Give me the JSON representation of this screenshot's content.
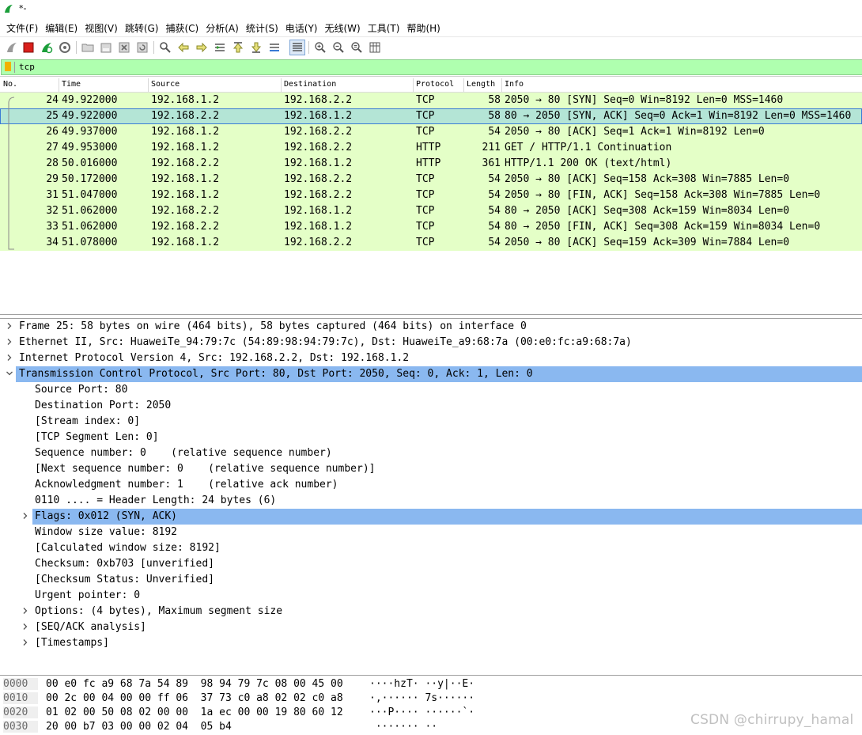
{
  "window": {
    "title": "*-"
  },
  "menu": [
    "文件(F)",
    "编辑(E)",
    "视图(V)",
    "跳转(G)",
    "捕获(C)",
    "分析(A)",
    "统计(S)",
    "电话(Y)",
    "无线(W)",
    "工具(T)",
    "帮助(H)"
  ],
  "toolbar": {
    "icons": [
      "shark-fin-icon",
      "stop-capture-icon",
      "restart-capture-icon",
      "capture-options-icon",
      "open-file-icon",
      "save-file-icon",
      "close-file-icon",
      "reload-file-icon",
      "find-packet-icon",
      "go-back-icon",
      "go-forward-icon",
      "go-to-packet-icon",
      "go-first-icon",
      "go-last-icon",
      "auto-scroll-icon",
      "colorize-icon",
      "zoom-in-icon",
      "zoom-out-icon",
      "zoom-normal-icon",
      "resize-columns-icon"
    ]
  },
  "filter": {
    "value": "tcp"
  },
  "packet_list": {
    "columns": [
      "No.",
      "Time",
      "Source",
      "Destination",
      "Protocol",
      "Length",
      "Info"
    ],
    "rows": [
      {
        "no": "24",
        "time": "49.922000",
        "src": "192.168.1.2",
        "dst": "192.168.2.2",
        "proto": "TCP",
        "len": "58",
        "info": "2050 → 80 [SYN] Seq=0 Win=8192 Len=0 MSS=1460"
      },
      {
        "no": "25",
        "time": "49.922000",
        "src": "192.168.2.2",
        "dst": "192.168.1.2",
        "proto": "TCP",
        "len": "58",
        "info": "80 → 2050 [SYN, ACK] Seq=0 Ack=1 Win=8192 Len=0 MSS=1460"
      },
      {
        "no": "26",
        "time": "49.937000",
        "src": "192.168.1.2",
        "dst": "192.168.2.2",
        "proto": "TCP",
        "len": "54",
        "info": "2050 → 80 [ACK] Seq=1 Ack=1 Win=8192 Len=0"
      },
      {
        "no": "27",
        "time": "49.953000",
        "src": "192.168.1.2",
        "dst": "192.168.2.2",
        "proto": "HTTP",
        "len": "211",
        "info": "GET / HTTP/1.1 Continuation"
      },
      {
        "no": "28",
        "time": "50.016000",
        "src": "192.168.2.2",
        "dst": "192.168.1.2",
        "proto": "HTTP",
        "len": "361",
        "info": "HTTP/1.1 200 OK  (text/html)"
      },
      {
        "no": "29",
        "time": "50.172000",
        "src": "192.168.1.2",
        "dst": "192.168.2.2",
        "proto": "TCP",
        "len": "54",
        "info": "2050 → 80 [ACK] Seq=158 Ack=308 Win=7885 Len=0"
      },
      {
        "no": "31",
        "time": "51.047000",
        "src": "192.168.1.2",
        "dst": "192.168.2.2",
        "proto": "TCP",
        "len": "54",
        "info": "2050 → 80 [FIN, ACK] Seq=158 Ack=308 Win=7885 Len=0"
      },
      {
        "no": "32",
        "time": "51.062000",
        "src": "192.168.2.2",
        "dst": "192.168.1.2",
        "proto": "TCP",
        "len": "54",
        "info": "80 → 2050 [ACK] Seq=308 Ack=159 Win=8034 Len=0"
      },
      {
        "no": "33",
        "time": "51.062000",
        "src": "192.168.2.2",
        "dst": "192.168.1.2",
        "proto": "TCP",
        "len": "54",
        "info": "80 → 2050 [FIN, ACK] Seq=308 Ack=159 Win=8034 Len=0"
      },
      {
        "no": "34",
        "time": "51.078000",
        "src": "192.168.1.2",
        "dst": "192.168.2.2",
        "proto": "TCP",
        "len": "54",
        "info": "2050 → 80 [ACK] Seq=159 Ack=309 Win=7884 Len=0"
      }
    ],
    "selected_index": 1
  },
  "details": [
    {
      "text": "Frame 25: 58 bytes on wire (464 bits), 58 bytes captured (464 bits) on interface 0",
      "indent": 0,
      "arrow": "right"
    },
    {
      "text": "Ethernet II, Src: HuaweiTe_94:79:7c (54:89:98:94:79:7c), Dst: HuaweiTe_a9:68:7a (00:e0:fc:a9:68:7a)",
      "indent": 0,
      "arrow": "right"
    },
    {
      "text": "Internet Protocol Version 4, Src: 192.168.2.2, Dst: 192.168.1.2",
      "indent": 0,
      "arrow": "right"
    },
    {
      "text": "Transmission Control Protocol, Src Port: 80, Dst Port: 2050, Seq: 0, Ack: 1, Len: 0",
      "indent": 0,
      "arrow": "down",
      "highlight": true
    },
    {
      "text": "Source Port: 80",
      "indent": 1,
      "arrow": ""
    },
    {
      "text": "Destination Port: 2050",
      "indent": 1,
      "arrow": ""
    },
    {
      "text": "[Stream index: 0]",
      "indent": 1,
      "arrow": ""
    },
    {
      "text": "[TCP Segment Len: 0]",
      "indent": 1,
      "arrow": ""
    },
    {
      "text": "Sequence number: 0    (relative sequence number)",
      "indent": 1,
      "arrow": ""
    },
    {
      "text": "[Next sequence number: 0    (relative sequence number)]",
      "indent": 1,
      "arrow": ""
    },
    {
      "text": "Acknowledgment number: 1    (relative ack number)",
      "indent": 1,
      "arrow": ""
    },
    {
      "text": "0110 .... = Header Length: 24 bytes (6)",
      "indent": 1,
      "arrow": ""
    },
    {
      "text": "Flags: 0x012 (SYN, ACK)",
      "indent": 1,
      "arrow": "right",
      "highlight": true
    },
    {
      "text": "Window size value: 8192",
      "indent": 1,
      "arrow": ""
    },
    {
      "text": "[Calculated window size: 8192]",
      "indent": 1,
      "arrow": ""
    },
    {
      "text": "Checksum: 0xb703 [unverified]",
      "indent": 1,
      "arrow": ""
    },
    {
      "text": "[Checksum Status: Unverified]",
      "indent": 1,
      "arrow": ""
    },
    {
      "text": "Urgent pointer: 0",
      "indent": 1,
      "arrow": ""
    },
    {
      "text": "Options: (4 bytes), Maximum segment size",
      "indent": 1,
      "arrow": "right"
    },
    {
      "text": "[SEQ/ACK analysis]",
      "indent": 1,
      "arrow": "right"
    },
    {
      "text": "[Timestamps]",
      "indent": 1,
      "arrow": "right"
    }
  ],
  "bytes": [
    {
      "offset": "0000",
      "hex": "00 e0 fc a9 68 7a 54 89  98 94 79 7c 08 00 45 00",
      "ascii": "····hzT· ··y|··E·"
    },
    {
      "offset": "0010",
      "hex": "00 2c 00 04 00 00 ff 06  37 73 c0 a8 02 02 c0 a8",
      "ascii": "·,······ 7s······"
    },
    {
      "offset": "0020",
      "hex": "01 02 00 50 08 02 00 00  1a ec 00 00 19 80 60 12",
      "ascii": "···P···· ······`·"
    },
    {
      "offset": "0030",
      "hex": "20 00 b7 03 00 00 02 04  05 b4",
      "ascii": " ······· ··"
    }
  ],
  "watermark": "CSDN @chirrupy_hamal",
  "colors": {
    "row_bg": "#e4ffc7",
    "row_selected": "#b4e5d6",
    "filter_ok": "#afffaf",
    "detail_highlight": "#8ab8f0"
  }
}
